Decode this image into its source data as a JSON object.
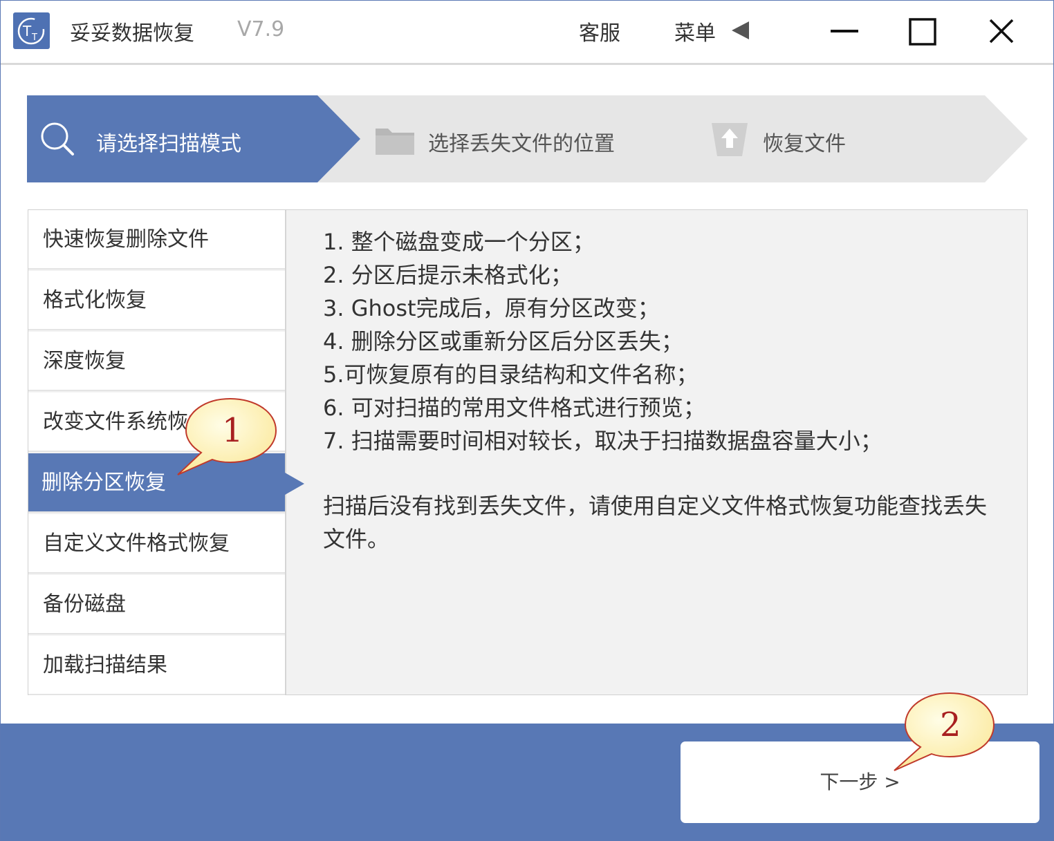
{
  "header": {
    "app_name": "妥妥数据恢复",
    "version": "V7.9",
    "service_label": "客服",
    "menu_label": "菜单",
    "logo_text": "T"
  },
  "steps": [
    {
      "label": "请选择扫描模式",
      "icon": "search-icon",
      "active": true
    },
    {
      "label": "选择丢失文件的位置",
      "icon": "folder-icon",
      "active": false
    },
    {
      "label": "恢复文件",
      "icon": "upload-icon",
      "active": false
    }
  ],
  "modes": [
    {
      "label": "快速恢复删除文件"
    },
    {
      "label": "格式化恢复"
    },
    {
      "label": "深度恢复"
    },
    {
      "label": "改变文件系统恢复"
    },
    {
      "label": "删除分区恢复",
      "selected": true
    },
    {
      "label": "自定义文件格式恢复"
    },
    {
      "label": "备份磁盘"
    },
    {
      "label": "加载扫描结果"
    }
  ],
  "description": {
    "lines": [
      "1. 整个磁盘变成一个分区；",
      "2. 分区后提示未格式化；",
      "3. Ghost完成后，原有分区改变；",
      "4. 删除分区或重新分区后分区丢失；",
      "5.可恢复原有的目录结构和文件名称；",
      "6. 可对扫描的常用文件格式进行预览；",
      "7. 扫描需要时间相对较长，取决于扫描数据盘容量大小；"
    ],
    "note": "扫描后没有找到丢失文件，请使用自定义文件格式恢复功能查找丢失文件。"
  },
  "footer": {
    "next_label": "下一步 >"
  },
  "callouts": [
    "1",
    "2"
  ],
  "colors": {
    "accent": "#5878b5",
    "step_inactive": "#e6e6e6",
    "callout_fill": "#fff9c8",
    "callout_text": "#a82020"
  }
}
